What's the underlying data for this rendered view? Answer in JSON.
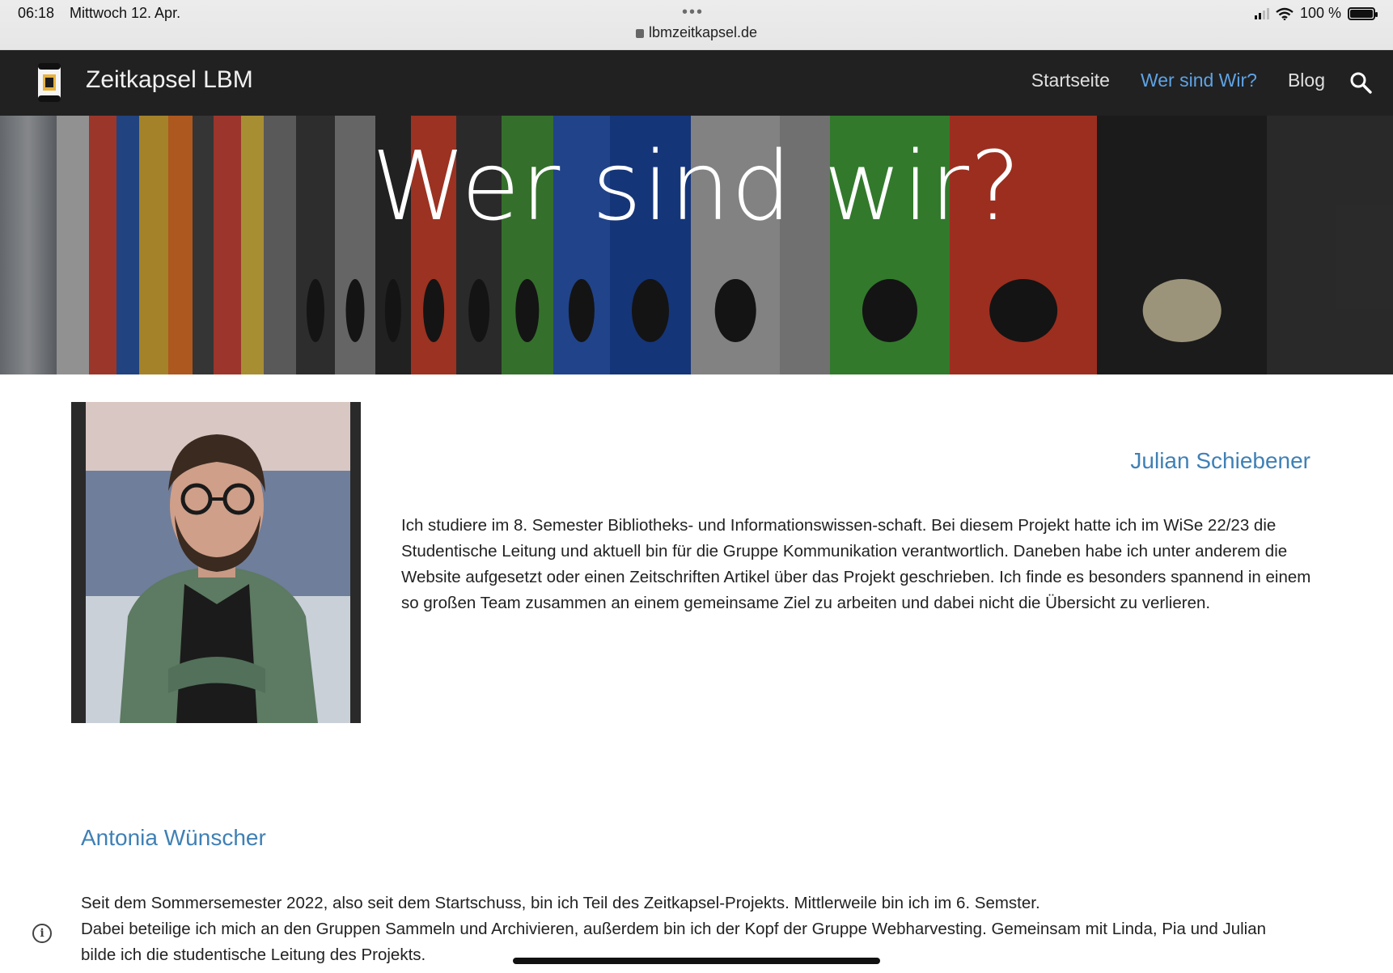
{
  "statusbar": {
    "time": "06:18",
    "date": "Mittwoch 12. Apr.",
    "url": "lbmzeitkapsel.de",
    "battery": "100 %"
  },
  "nav": {
    "site_title": "Zeitkapsel LBM",
    "links": [
      {
        "label": "Startseite",
        "active": false
      },
      {
        "label": "Wer sind Wir?",
        "active": true
      },
      {
        "label": "Blog",
        "active": false
      }
    ],
    "search_icon": "search-icon"
  },
  "hero": {
    "title": "Wer sind wir?"
  },
  "members": [
    {
      "name": "Julian Schiebener",
      "bio": "Ich studiere im 8. Semester Bibliotheks- und Informationswissen-schaft. Bei diesem Projekt hatte ich im WiSe 22/23 die Studentische Leitung und aktuell bin für die Gruppe Kommunikation verantwortlich. Daneben habe ich unter anderem die Website aufgesetzt oder einen Zeitschriften Artikel über das Projekt geschrieben. Ich finde es besonders spannend in einem so großen Team zusammen an einem gemeinsame Ziel zu arbeiten und dabei nicht die Übersicht zu verlieren."
    },
    {
      "name": "Antonia Wünscher",
      "bio_lines": [
        "Seit dem Sommersemester 2022, also seit dem Startschuss, bin ich Teil des Zeitkapsel-Projekts. Mittlerweile bin ich im 6. Semster.",
        "Dabei beteilige ich mich an den Gruppen Sammeln und Archivieren, außerdem bin ich der Kopf der Gruppe Webharvesting. Gemeinsam mit Linda, Pia und Julian bilde ich die studentische Leitung des Projekts."
      ]
    }
  ],
  "colors": {
    "nav_bg": "#212121",
    "accent": "#5ea3e6",
    "name_color": "#3f80b5"
  }
}
